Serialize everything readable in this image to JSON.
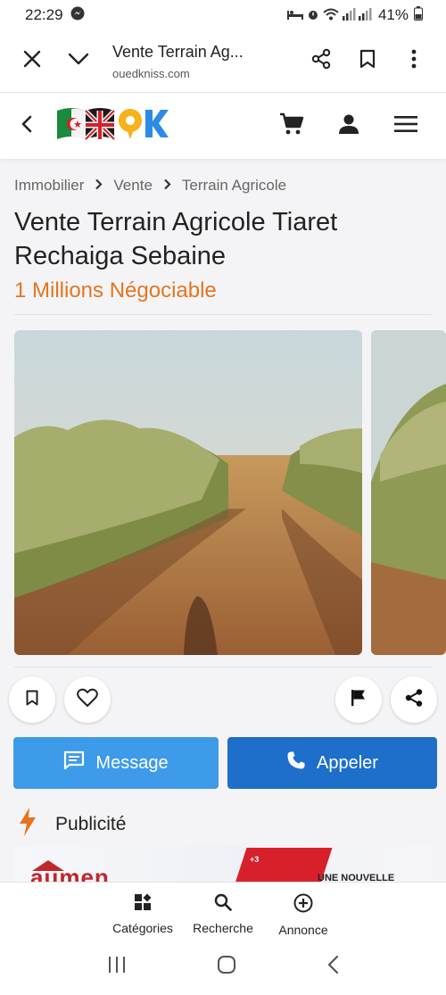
{
  "status_bar": {
    "time": "22:29",
    "battery": "41%",
    "icons": [
      "messenger-icon",
      "alarm-icon",
      "wifi-icon",
      "signal-icon"
    ]
  },
  "browser": {
    "title": "Vente Terrain Ag...",
    "domain": "ouedkniss.com",
    "icons": [
      "close-icon",
      "chevron-down-icon",
      "share-icon",
      "bookmark-icon",
      "more-icon"
    ]
  },
  "site_header": {
    "logo_text": "OK",
    "icons": [
      "chevron-left-icon",
      "cart-icon",
      "account-icon",
      "menu-icon"
    ]
  },
  "breadcrumb": {
    "items": [
      "Immobilier",
      "Vente",
      "Terrain Agricole"
    ]
  },
  "listing": {
    "title": "Vente Terrain Agricole Tiaret Rechaiga Sebaine",
    "price": "1 Millions Négociable"
  },
  "actions": {
    "icons": [
      "bookmark-icon",
      "heart-icon",
      "flag-icon",
      "share-icon"
    ]
  },
  "cta": {
    "message_label": "Message",
    "call_label": "Appeler"
  },
  "ad_section": {
    "label": "Publicité",
    "banner_logo": "aumen",
    "banner_promo": "+3",
    "banner_tagline": "UNE NOUVELLE"
  },
  "bottom_nav": {
    "items": [
      {
        "label": "Catégories",
        "icon": "categories-icon"
      },
      {
        "label": "Recherche",
        "icon": "search-icon"
      },
      {
        "label": "Annonce",
        "icon": "add-circle-icon"
      }
    ]
  },
  "colors": {
    "accent_orange": "#e4751f",
    "message_blue": "#3d9be9",
    "call_blue": "#1e6fc9",
    "logo_yellow": "#f6b21b",
    "logo_blue": "#2b8be6"
  }
}
